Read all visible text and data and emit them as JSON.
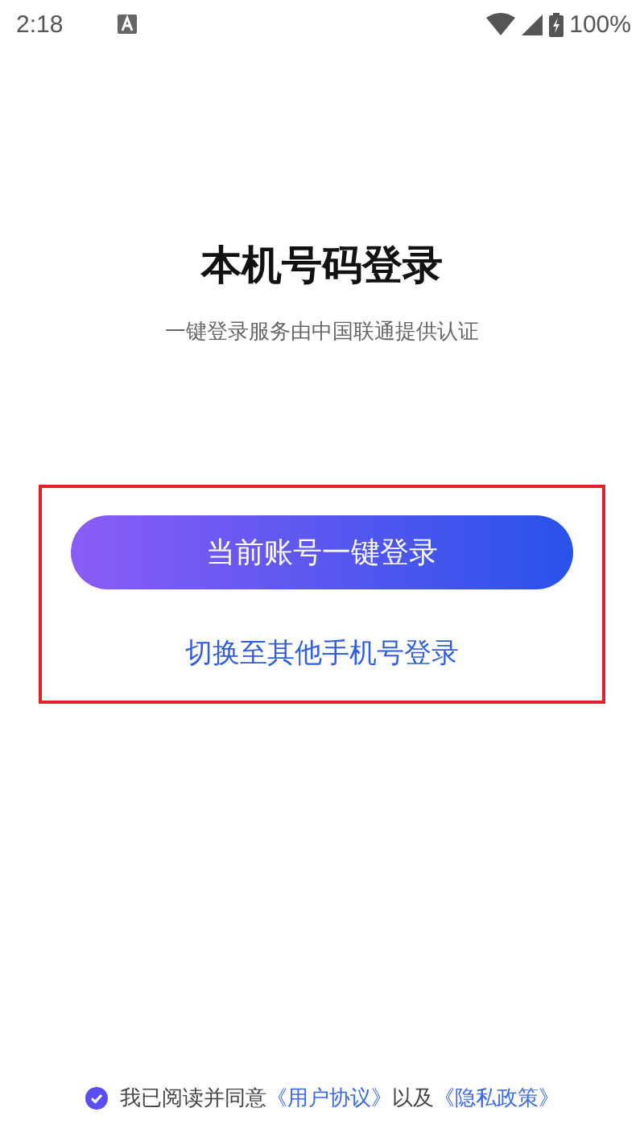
{
  "status_bar": {
    "time": "2:18",
    "battery": "100%"
  },
  "title": "本机号码登录",
  "subtitle": "一键登录服务由中国联通提供认证",
  "highlight": true,
  "primary_button": "当前账号一键登录",
  "switch_link": "切换至其他手机号登录",
  "agreement": {
    "checked": true,
    "parts": [
      {
        "kind": "text",
        "text": "我已阅读并同意"
      },
      {
        "kind": "link",
        "text": "《用户协议》"
      },
      {
        "kind": "text",
        "text": "以及"
      },
      {
        "kind": "link",
        "text": "《隐私政策》"
      }
    ]
  }
}
